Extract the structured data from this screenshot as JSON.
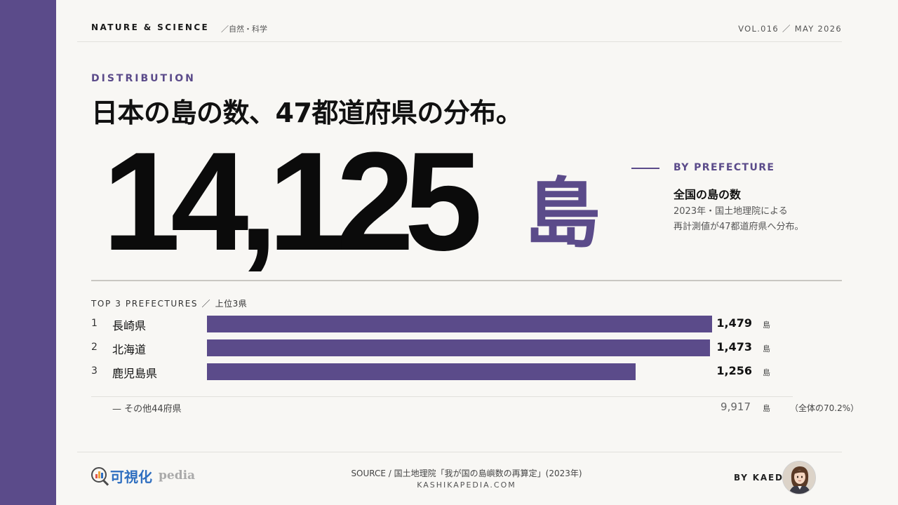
{
  "header": {
    "brand": "NATURE & SCIENCE",
    "category": "／自然・科学",
    "issue": "VOL.016 ／ MAY 2026"
  },
  "kicker": "DISTRIBUTION",
  "title": "日本の島の数、47都道府県の分布。",
  "hero": {
    "number": "14,125",
    "unit": "島"
  },
  "side": {
    "kicker": "BY PREFECTURE",
    "heading": "全国の島の数",
    "desc_line1": "2023年・国土地理院による",
    "desc_line2": "再計測値が47都道府県へ分布。"
  },
  "top3": {
    "label": "TOP 3 PREFECTURES ／",
    "label_ja": "上位3県"
  },
  "chart_data": {
    "type": "bar",
    "orientation": "horizontal",
    "title": "TOP 3 PREFECTURES ／ 上位3県",
    "unit": "島",
    "categories": [
      "長崎県",
      "北海道",
      "鹿児島県"
    ],
    "ranks": [
      "1",
      "2",
      "3"
    ],
    "values": [
      1479,
      1473,
      1256
    ],
    "value_labels": [
      "1,479",
      "1,473",
      "1,256"
    ],
    "xlim": [
      0,
      1479
    ],
    "bar_color": "#5b4b8a",
    "others": {
      "label": "— その他44府県",
      "value": 9917,
      "value_label": "9,917",
      "unit": "島",
      "share": "（全体の70.2%）"
    }
  },
  "footer": {
    "logo_main": "可視化",
    "logo_tail": "pedia",
    "source": "SOURCE / 国土地理院「我が国の島嶼数の再算定」(2023年)",
    "site": "KASHIKAPEDIA.COM",
    "byline": "BY KAEDE"
  },
  "colors": {
    "accent": "#5b4b8a",
    "background": "#f8f7f4",
    "logo_blue": "#2f6fc0"
  }
}
